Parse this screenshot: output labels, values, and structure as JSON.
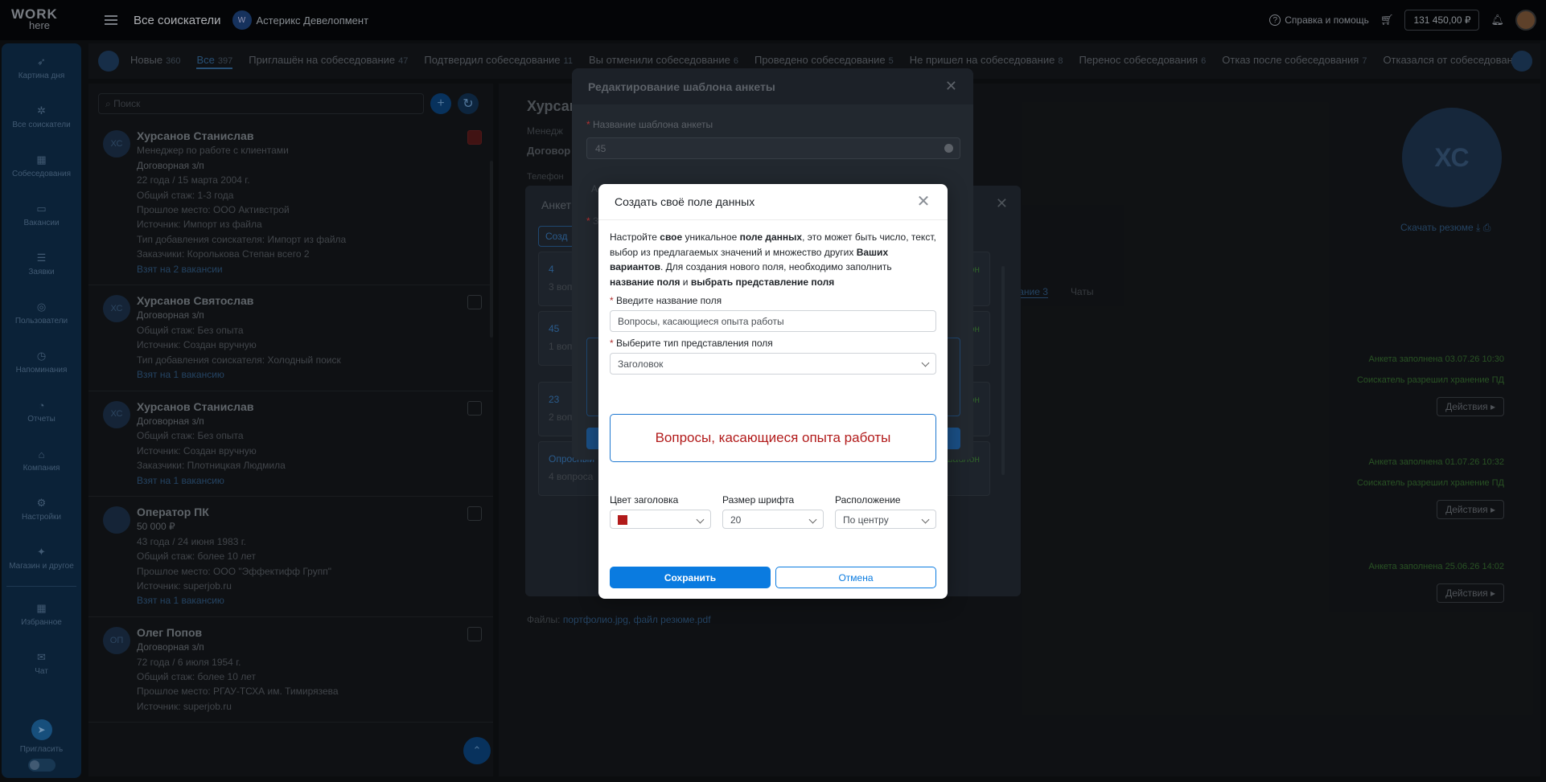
{
  "header": {
    "logo_line1": "WORK",
    "logo_line2": "here",
    "page_title": "Все соискатели",
    "company_badge": "W",
    "company_name": "Астерикс Девелопмент",
    "help_label": "Справка и помощь",
    "help_icon": "?",
    "balance": "131 450,00 ₽"
  },
  "sidebar": {
    "items": [
      {
        "label": "Картина дня",
        "icon": "➶"
      },
      {
        "label": "Все соискатели",
        "icon": "✲"
      },
      {
        "label": "Собеседования",
        "icon": "▦"
      },
      {
        "label": "Вакансии",
        "icon": "▭"
      },
      {
        "label": "Заявки",
        "icon": "☰"
      },
      {
        "label": "Пользователи",
        "icon": "◎"
      },
      {
        "label": "Напоминания",
        "icon": "◷"
      },
      {
        "label": "Отчеты",
        "icon": "◔"
      },
      {
        "label": "Компания",
        "icon": "⌂"
      },
      {
        "label": "Настройки",
        "icon": "⚙"
      },
      {
        "label": "Магазин и другое",
        "icon": "✦"
      },
      {
        "label": "Избранное",
        "icon": "▦"
      },
      {
        "label": "Чат",
        "icon": "✉"
      }
    ],
    "invite_label": "Пригласить",
    "invite_icon": "➤"
  },
  "status_tabs": [
    {
      "label": "Новые",
      "count": "360",
      "active": false
    },
    {
      "label": "Все",
      "count": "397",
      "active": true
    },
    {
      "label": "Приглашён на собеседование",
      "count": "47",
      "active": false
    },
    {
      "label": "Подтвердил собеседование",
      "count": "11",
      "active": false
    },
    {
      "label": "Вы отменили собеседование",
      "count": "6",
      "active": false
    },
    {
      "label": "Проведено собеседование",
      "count": "5",
      "active": false
    },
    {
      "label": "Не пришел на собеседование",
      "count": "8",
      "active": false
    },
    {
      "label": "Перенос собеседования",
      "count": "6",
      "active": false
    },
    {
      "label": "Отказ после собеседования",
      "count": "7",
      "active": false
    },
    {
      "label": "Отказался от собеседования",
      "count": "2",
      "active": false
    }
  ],
  "list": {
    "search_placeholder": "Поиск",
    "add_icon": "+",
    "candidates": [
      {
        "initials": "ХС",
        "name": "Хурсанов Станислав",
        "lines": [
          "Менеджер по работе с клиентами"
        ],
        "salary": "Договорная з/п",
        "details": [
          "22 года / 15 марта 2004 г.",
          "Общий стаж:  1-3 года",
          "Прошлое место:  ООО Активстрой",
          "Источник:  Импорт из файла",
          "Тип добавления соискателя:  Импорт из файла",
          "Заказчики:  Королькова Степан  всего 2"
        ],
        "link": "Взят на 2 вакансии"
      },
      {
        "initials": "ХС",
        "name": "Хурсанов Святослав",
        "lines": [],
        "salary": "Договорная з/п",
        "details": [
          "Общий стаж:  Без опыта",
          "Источник:  Создан вручную",
          "Тип добавления соискателя:  Холодный поиск"
        ],
        "link": "Взят на 1 вакансию"
      },
      {
        "initials": "ХС",
        "name": "Хурсанов Станислав",
        "lines": [],
        "salary": "Договорная з/п",
        "details": [
          "Общий стаж:  Без опыта",
          "Источник:  Создан вручную",
          "Заказчики:  Плотницкая Людмила"
        ],
        "link": "Взят на 1 вакансию"
      },
      {
        "initials": "",
        "name": "Оператор ПК",
        "lines": [],
        "salary": "50 000 ₽",
        "details": [
          "43 года / 24 июня 1983 г.",
          "Общий стаж:  более 10 лет",
          "Прошлое место:  ООО \"Эффектифф Групп\"",
          "Источник:  superjob.ru"
        ],
        "link": "Взят на 1 вакансию"
      },
      {
        "initials": "ОП",
        "name": "Олег Попов",
        "lines": [],
        "salary": "Договорная з/п",
        "details": [
          "72 года / 6 июля 1954 г.",
          "Общий стаж:  более 10 лет",
          "Прошлое место:  РГАУ-ТСХА им. Тимирязева",
          "Источник:  superjob.ru"
        ],
        "link": ""
      }
    ]
  },
  "detail": {
    "name": "Хурсан",
    "role": "Менедж",
    "salary": "Договор",
    "phone": "Телефон",
    "avatar_initials": "ХС",
    "download_resume": "Скачать резюме",
    "tab_interviews": "вание 3",
    "tab_chats": "Чаты",
    "anketa_1_filled": "Анкета заполнена 03.07.26 10:30",
    "anketa_1_consent": "Соискатель разрешил хранение ПД",
    "anketa_2_filled": "Анкета заполнена 01.07.26 10:32",
    "anketa_2_consent": "Соискатель разрешил хранение ПД",
    "anketa_3_filled": "Анкета заполнена 25.06.26 14:02",
    "actions_label": "Действия ▸",
    "files_label": "Файлы:",
    "files_value": "портфолио.jpg, файл резюме.pdf"
  },
  "back_modal": {
    "title": "Анкет",
    "close_icon": "✕",
    "create_label": "Созд",
    "rows": [
      {
        "num": "4",
        "sub": "3 вопр",
        "tpl": "он"
      },
      {
        "num": "45",
        "sub": "1 вопр",
        "tpl": "он"
      },
      {
        "num": "23",
        "sub": "2 вопроса",
        "tpl": "он"
      },
      {
        "num": "Опросный",
        "sub": "4 вопроса",
        "tpl": "шаблон"
      }
    ]
  },
  "mid_modal": {
    "title": "Редактирование шаблона анкеты",
    "close_icon": "✕",
    "label": "Название шаблона анкеты",
    "value": "45",
    "ghost_letter": "А",
    "ghost_req": "З"
  },
  "front_modal": {
    "title": "Создать своё поле данных",
    "close_icon": "✕",
    "desc_1": "Настройте ",
    "desc_b1": "свое",
    "desc_2": " уникальное ",
    "desc_b2": "поле данных",
    "desc_3": ", это может быть число, текст, выбор из предлагаемых значений и множество других ",
    "desc_b3": "Ваших вариантов",
    "desc_4": ". Для создания нового поля, необходимо заполнить ",
    "desc_b4": "название поля",
    "desc_5": " и ",
    "desc_b5": "выбрать представление поля",
    "name_label": "Введите название поля",
    "name_value": "Вопросы, касающиеся опыта работы",
    "type_label": "Выберите тип представления поля",
    "type_value": "Заголовок",
    "preview_text": "Вопросы, касающиеся опыта работы",
    "color_label": "Цвет заголовка",
    "color_value": "#b21b1b",
    "size_label": "Размер шрифта",
    "size_value": "20",
    "align_label": "Расположение",
    "align_value": "По центру",
    "save_label": "Сохранить",
    "cancel_label": "Отмена"
  }
}
